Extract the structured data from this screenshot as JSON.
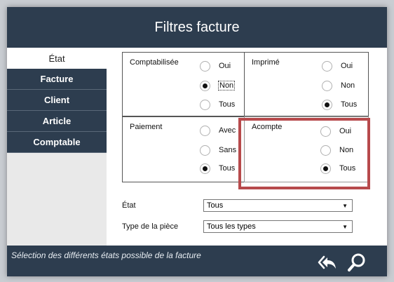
{
  "window": {
    "title": "Filtres facture"
  },
  "sidebar": {
    "items": [
      {
        "label": "État",
        "active": true
      },
      {
        "label": "Facture"
      },
      {
        "label": "Client"
      },
      {
        "label": "Article"
      },
      {
        "label": "Comptable"
      }
    ]
  },
  "groups": {
    "comptabilisee": {
      "title": "Comptabilisée",
      "options": [
        "Oui",
        "Non",
        "Tous"
      ],
      "selected": "Non"
    },
    "imprime": {
      "title": "Imprimé",
      "options": [
        "Oui",
        "Non",
        "Tous"
      ],
      "selected": "Tous"
    },
    "paiement": {
      "title": "Paiement",
      "options": [
        "Avec",
        "Sans",
        "Tous"
      ],
      "selected": "Tous"
    },
    "acompte": {
      "title": "Acompte",
      "options": [
        "Oui",
        "Non",
        "Tous"
      ],
      "selected": "Tous"
    }
  },
  "fields": {
    "etat": {
      "label": "État",
      "value": "Tous"
    },
    "type_piece": {
      "label": "Type de la pièce",
      "value": "Tous les types"
    }
  },
  "status": {
    "text": "Sélection des différents états possible de la facture"
  },
  "icons": {
    "back": "double-reply-icon",
    "search": "search-icon"
  },
  "colors": {
    "primary": "#2d3d4f",
    "highlight": "#b74a4c"
  }
}
